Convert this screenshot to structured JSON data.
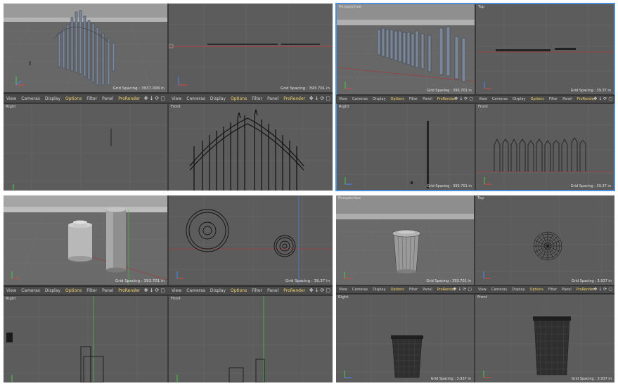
{
  "menu": {
    "view": "View",
    "cameras": "Cameras",
    "display": "Display",
    "options": "Options",
    "filter": "Filter",
    "panel": "Panel",
    "prorender": "ProRender"
  },
  "nav_icons": [
    "move-icon",
    "zoom-icon",
    "rotate-icon",
    "maximize-icon"
  ],
  "panels": [
    {
      "id": "fence-left",
      "perspective": {
        "label": "",
        "grid": "Grid Spacing : 3937.008 in"
      },
      "top": {
        "label": "",
        "grid": "Grid Spacing : 393.701 in"
      },
      "right": {
        "label": "Right",
        "grid": ""
      },
      "front": {
        "label": "Front",
        "grid": ""
      }
    },
    {
      "id": "fence-right",
      "perspective": {
        "label": "Perspective",
        "grid": "Grid Spacing : 393.701 in"
      },
      "top": {
        "label": "Top",
        "grid": "Grid Spacing : 39.37 in"
      },
      "right": {
        "label": "Right",
        "grid": "Grid Spacing : 393.701 in"
      },
      "front": {
        "label": "Front",
        "grid": "Grid Spacing : 39.37 in"
      }
    },
    {
      "id": "cylinders",
      "perspective": {
        "label": "",
        "grid": "Grid Spacing : 393.701 in"
      },
      "top": {
        "label": "",
        "grid": "Grid Spacing : 39.37 in"
      },
      "right": {
        "label": "Right",
        "grid": ""
      },
      "front": {
        "label": "Front",
        "grid": ""
      }
    },
    {
      "id": "trashcan",
      "perspective": {
        "label": "Perspective",
        "grid": "Grid Spacing : 393.701 in"
      },
      "top": {
        "label": "Top",
        "grid": "Grid Spacing : 3.937 in"
      },
      "right": {
        "label": "Right",
        "grid": "Grid Spacing : 3.937 in"
      },
      "front": {
        "label": "Front",
        "grid": "Grid Spacing : 3.937 in"
      }
    }
  ]
}
